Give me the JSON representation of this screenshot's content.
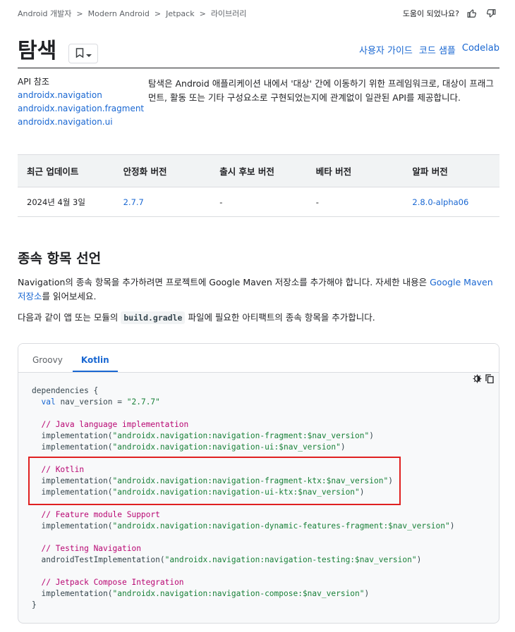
{
  "breadcrumb": [
    "Android 개발자",
    "Modern Android",
    "Jetpack",
    "라이브러리"
  ],
  "breadcrumb_sep": ">",
  "feedback": {
    "label": "도움이 되었나요?"
  },
  "page": {
    "title": "탐색",
    "links": [
      "사용자 가이드",
      "코드 샘플",
      "Codelab"
    ]
  },
  "api": {
    "label": "API 참조",
    "packages": [
      "androidx.navigation",
      "androidx.navigation.fragment",
      "androidx.navigation.ui"
    ]
  },
  "intro": "탐색은 Android 애플리케이션 내에서 '대상' 간에 이동하기 위한 프레임워크로, 대상이 프래그먼트, 활동 또는 기타 구성요소로 구현되었는지에 관계없이 일관된 API를 제공합니다.",
  "versions": {
    "headers": [
      "최근 업데이트",
      "안정화 버전",
      "출시 후보 버전",
      "베타 버전",
      "알파 버전"
    ],
    "row": [
      "2024년 4월 3일",
      "2.7.7",
      "-",
      "-",
      "2.8.0-alpha06"
    ]
  },
  "dependencies": {
    "title": "종속 항목 선언",
    "para1_before": "Navigation의 종속 항목을 추가하려면 프로젝트에 Google Maven 저장소를 추가해야 합니다. 자세한 내용은 ",
    "para1_link": "Google Maven 저장소",
    "para1_after": "를 읽어보세요.",
    "para2_before": "다음과 같이 앱 또는 모듈의 ",
    "para2_code": "build.gradle",
    "para2_after": " 파일에 필요한 아티팩트의 종속 항목을 추가합니다."
  },
  "code": {
    "tabs": [
      "Groovy",
      "Kotlin"
    ],
    "active_tab": "Kotlin",
    "lines": {
      "l1": "dependencies {",
      "l2_kw": "val",
      "l2_rest": " nav_version = ",
      "l2_str": "\"2.7.7\"",
      "c1": "// Java language implementation",
      "i1": "\"androidx.navigation:navigation-fragment:$nav_version\"",
      "i2": "\"androidx.navigation:navigation-ui:$nav_version\"",
      "c2": "// Kotlin",
      "i3": "\"androidx.navigation:navigation-fragment-ktx:$nav_version\"",
      "i4": "\"androidx.navigation:navigation-ui-ktx:$nav_version\"",
      "c3": "// Feature module Support",
      "i5": "\"androidx.navigation:navigation-dynamic-features-fragment:$nav_version\"",
      "c4": "// Testing Navigation",
      "i6": "\"androidx.navigation:navigation-testing:$nav_version\"",
      "c5": "// Jetpack Compose Integration",
      "i7": "\"androidx.navigation:navigation-compose:$nav_version\"",
      "close": "}",
      "impl": "implementation",
      "test_impl": "androidTestImplementation"
    }
  },
  "colors": {
    "link": "#1967d2",
    "highlight": "#e02020",
    "comment": "#b80672",
    "string": "#188038"
  }
}
